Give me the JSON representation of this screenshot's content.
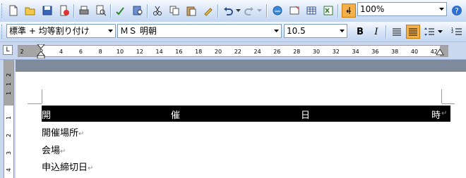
{
  "toolbar_standard": {
    "zoom_value": "100%"
  },
  "toolbar_formatting": {
    "style_value": "標準 + 均等割り付け",
    "font_value": "ＭＳ 明朝",
    "size_value": "10.5",
    "bold_label": "B",
    "italic_label": "I"
  },
  "ruler": {
    "labels": [
      "2",
      "2",
      "4",
      "6",
      "8",
      "10",
      "12",
      "14",
      "16",
      "18",
      "20",
      "22",
      "24",
      "26",
      "28",
      "30",
      "32",
      "34",
      "36",
      "38",
      "40",
      "42"
    ]
  },
  "vruler": {
    "labels": [
      "2",
      "1",
      "1",
      "1",
      "2",
      "3",
      "4"
    ]
  },
  "document": {
    "heading_chars": [
      "開",
      "催",
      "日",
      "時"
    ],
    "paragraph_mark": "↵",
    "lines": [
      "開催場所",
      "会場",
      "申込締切日"
    ]
  },
  "colors": {
    "toolbar_top": "#f6f9fe",
    "toolbar_bottom": "#c3d6f1",
    "highlight": "#000000",
    "accent_orange": "#f4b04a"
  }
}
